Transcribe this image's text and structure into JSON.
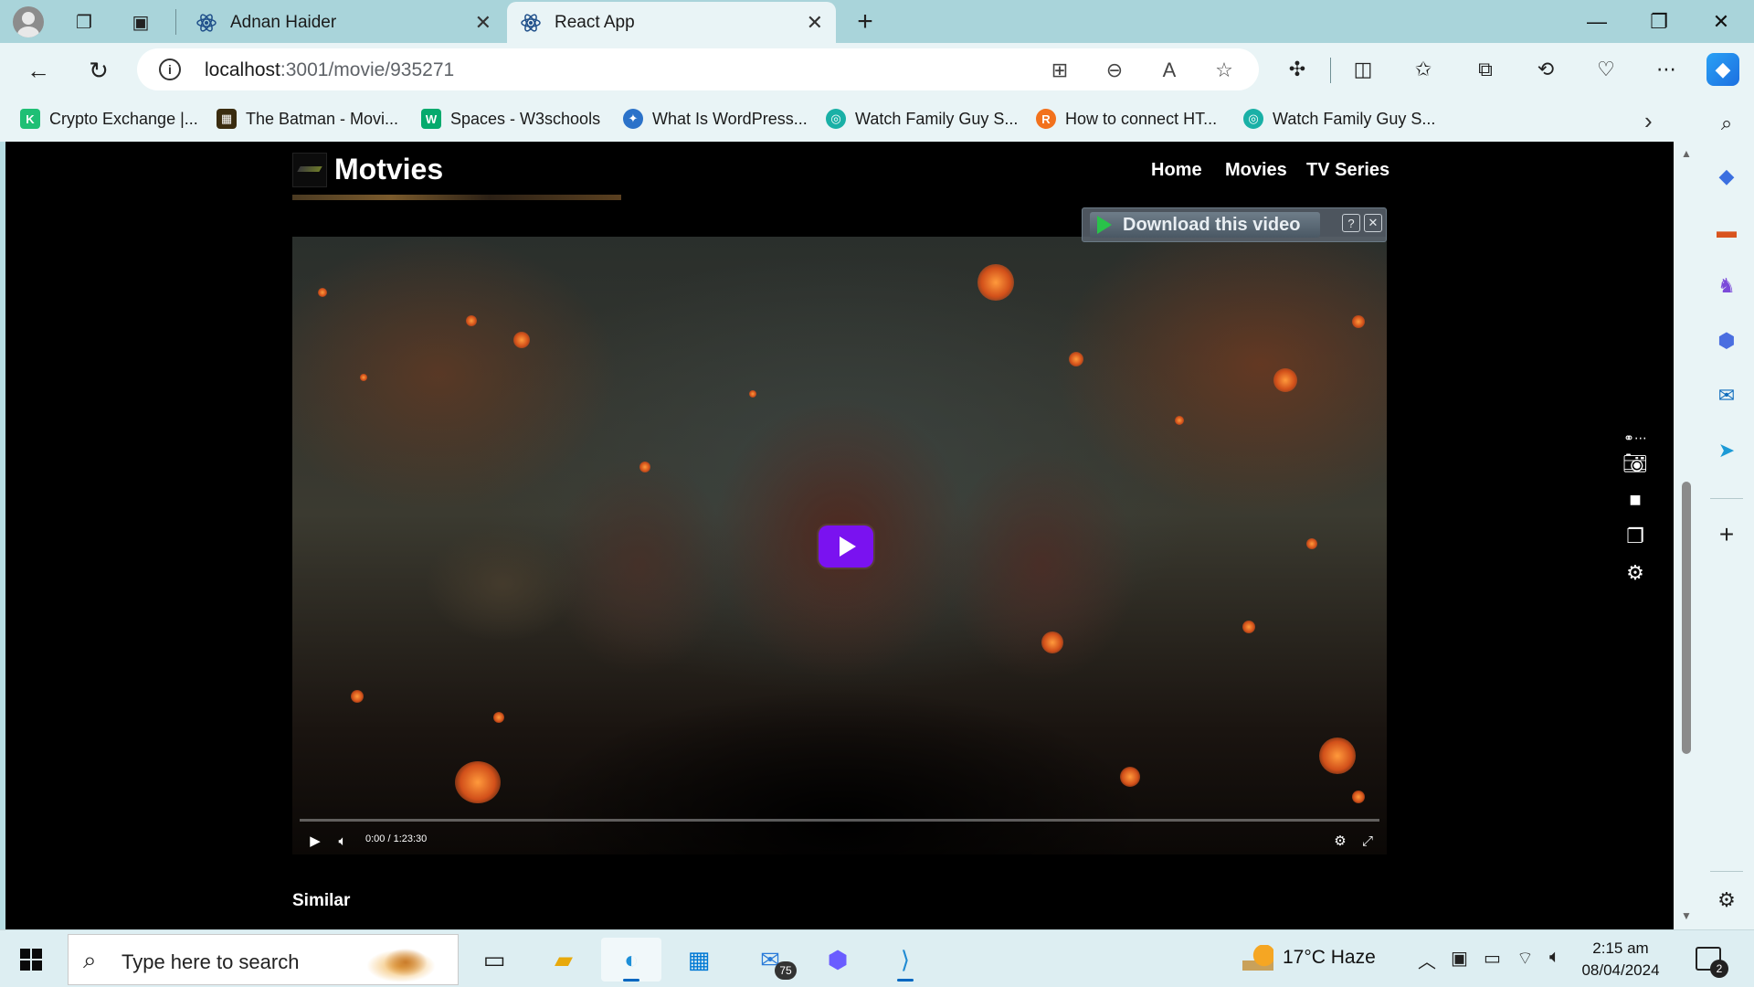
{
  "browser": {
    "tabs": [
      {
        "label": "Adnan Haider",
        "active": false
      },
      {
        "label": "React App",
        "active": true
      }
    ],
    "address_bar": {
      "host": "localhost",
      "path": ":3001/movie/935271"
    },
    "favorites": [
      {
        "label": "Crypto Exchange |...",
        "icon_color": "#1fbf75",
        "icon_text": "K"
      },
      {
        "label": "The Batman - Movi...",
        "icon_color": "#3a2c10",
        "icon_text": "▦"
      },
      {
        "label": "Spaces - W3schools",
        "icon_color": "#04aa6d",
        "icon_text": "W"
      },
      {
        "label": "What Is WordPress...",
        "icon_color": "#2b72c9",
        "icon_text": "✦"
      },
      {
        "label": "Watch Family Guy S...",
        "icon_color": "#19b0a6",
        "icon_text": "◎"
      },
      {
        "label": "How to connect HT...",
        "icon_color": "#f2711c",
        "icon_text": "R"
      },
      {
        "label": "Watch Family Guy S...",
        "icon_color": "#19b0a6",
        "icon_text": "◎"
      }
    ]
  },
  "site": {
    "title": "Motvies",
    "nav": [
      "Home",
      "Movies",
      "TV Series"
    ]
  },
  "player": {
    "time": "0:00 / 1:23:30",
    "progress": 0,
    "download_label": "Download this video",
    "help_label": "?",
    "close_label": "✕"
  },
  "section": {
    "similar_heading": "Similar"
  },
  "taskbar": {
    "search_placeholder": "Type here to search",
    "mail_badge": "75",
    "weather": "17°C  Haze",
    "time": "2:15 am",
    "date": "08/04/2024",
    "notifications": "2"
  },
  "colors": {
    "accent_play": "#7a12f0",
    "tab_bar": "#a9d4da",
    "toolbar": "#e9f4f6"
  }
}
